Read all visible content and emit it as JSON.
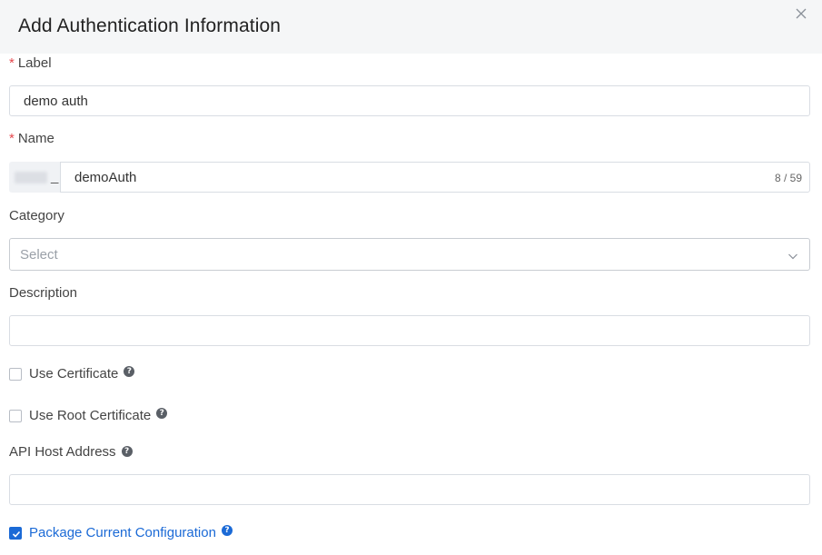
{
  "dialog": {
    "title": "Add Authentication Information"
  },
  "fields": {
    "label": {
      "required_mark": "*",
      "label": "Label",
      "value": "demo auth"
    },
    "name": {
      "required_mark": "*",
      "label": "Name",
      "prefix_separator": "_",
      "value": "demoAuth",
      "counter": "8 / 59"
    },
    "category": {
      "label": "Category",
      "placeholder": "Select"
    },
    "description": {
      "label": "Description",
      "value": ""
    },
    "use_certificate": {
      "label": "Use Certificate",
      "checked": false
    },
    "use_root_certificate": {
      "label": "Use Root Certificate",
      "checked": false
    },
    "api_host": {
      "label": "API Host Address",
      "value": ""
    },
    "package_config": {
      "label": "Package Current Configuration",
      "checked": true
    }
  },
  "icons": {
    "close": "close-icon",
    "chevron": "chevron-down-icon",
    "help": "question-circle-icon",
    "check": "check-icon"
  },
  "colors": {
    "accent": "#1b6ad6",
    "required": "#e5484d",
    "header_bg": "#f5f6f7",
    "border": "#d9dde3"
  }
}
